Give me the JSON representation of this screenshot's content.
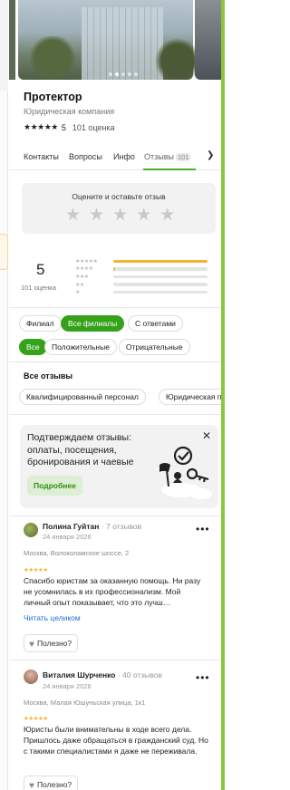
{
  "company": {
    "name": "Протектор",
    "category": "Юридическая компания",
    "rating": "5",
    "reviews_count": "101 оценка",
    "rating_stars": "★★★★★"
  },
  "photo": {
    "slide_count": 5,
    "active_index": 1
  },
  "tabs": [
    {
      "label": "Контакты"
    },
    {
      "label": "Вопросы"
    },
    {
      "label": "Инфо"
    },
    {
      "label": "Отзывы",
      "badge": "101",
      "active": true
    }
  ],
  "rate_prompt": {
    "title": "Оцените и оставьте отзыв",
    "stars": "★"
  },
  "summary": {
    "score": "5",
    "count": "101 оценка",
    "distribution": [
      {
        "stars": "★★★★★",
        "fraction": 1.0
      },
      {
        "stars": "★★★★",
        "fraction": 0.02
      },
      {
        "stars": "★★★",
        "fraction": 0.0
      },
      {
        "stars": "★★",
        "fraction": 0.0
      },
      {
        "stars": "★",
        "fraction": 0.0
      }
    ]
  },
  "filters": {
    "branch": [
      "Филиал",
      "Все филиалы",
      "С ответами"
    ],
    "branch_active": 1,
    "tone": [
      "Все",
      "Положительные",
      "Отрицательные"
    ],
    "tone_active": 0
  },
  "all_reviews_title": "Все отзывы",
  "topics": [
    "Квалифицированный персонал",
    "Юридическая п"
  ],
  "promo": {
    "text": "Подтверждаем отзывы: оплаты, посещения, бронирования и чаевые",
    "button": "Подробнее",
    "close": "✕"
  },
  "reviews": [
    {
      "name": "Полина Гуйтан",
      "meta": " · 7 отзывов",
      "date": "24 января 2026",
      "address": "Москва, Волоколамское шоссе, 2",
      "stars": "★★★★★",
      "text": "Спасибо юристам за оказанную помощь. Ни разу не усомнилась в их профессионализм. Мой личный опыт показывает, что это лучш…",
      "read_more": "Читать целиком",
      "useful": "Полезно?",
      "more": "•••"
    },
    {
      "name": "Виталия Шурченко",
      "meta": " · 40 отзывов",
      "date": "24 января 2026",
      "address": "Москва, Малая Юшуньская улица, 1к1",
      "stars": "★★★★★",
      "text": "Юристы были внимательны в ходе всего дела. Пришлось даже обращаться в гражданский суд. Но с такими специалистами я даже не переживала.",
      "useful": "Полезно?",
      "more": "•••"
    }
  ],
  "colors": {
    "accent_green": "#36a21b",
    "star_yellow": "#f5b22e",
    "right_bar": "#8cc63f"
  }
}
